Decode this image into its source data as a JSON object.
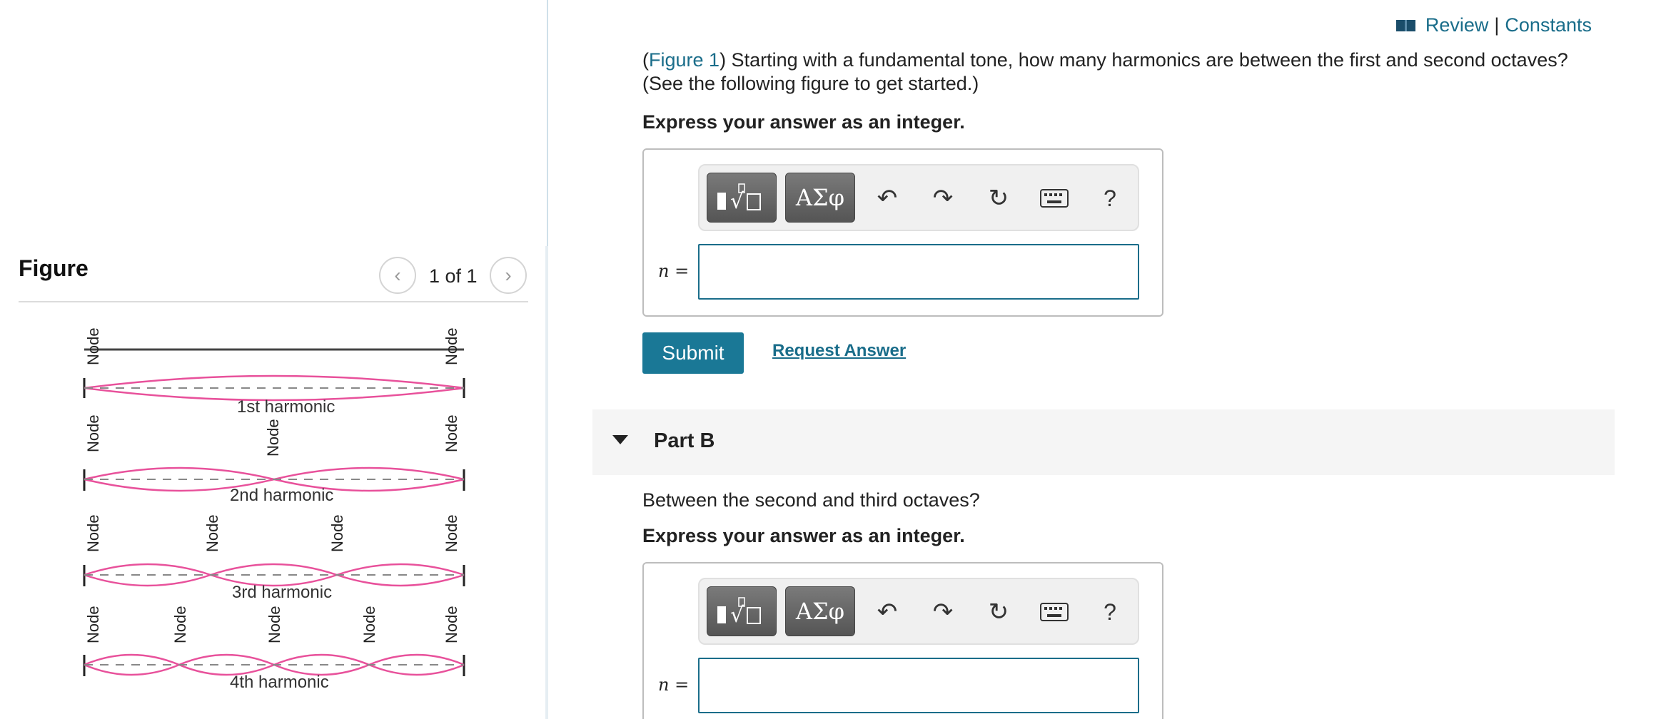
{
  "figure_panel": {
    "title": "Figure",
    "pager_text": "1 of 1",
    "prev_icon": "chevron-left-icon",
    "next_icon": "chevron-right-icon",
    "node_label": "Node",
    "harmonics": [
      {
        "label": "1st harmonic"
      },
      {
        "label": "2nd harmonic"
      },
      {
        "label": "3rd harmonic"
      },
      {
        "label": "4th harmonic"
      }
    ]
  },
  "header_links": {
    "review": "Review",
    "separator": "|",
    "constants": "Constants",
    "icon": "book-icon"
  },
  "part_a": {
    "question_prefix": "(",
    "figure_link": "Figure 1",
    "question_text": ") Starting with a fundamental tone, how many harmonics are between the first and second octaves? (See the following figure to get started.)",
    "instruction": "Express your answer as an integer.",
    "variable_label": "n =",
    "input_value": "",
    "submit_label": "Submit",
    "request_label": "Request Answer"
  },
  "toolbar": {
    "greek_label": "ΑΣφ",
    "help_label": "?",
    "icons": [
      "templates-icon",
      "greek-icon",
      "undo-icon",
      "redo-icon",
      "reset-icon",
      "keyboard-icon",
      "help-icon"
    ]
  },
  "part_b": {
    "title": "Part B",
    "question_text": "Between the second and third octaves?",
    "instruction": "Express your answer as an integer.",
    "variable_label": "n =",
    "input_value": ""
  },
  "colors": {
    "accent": "#1a7896",
    "link": "#1a6d8a",
    "wave": "#e8519b"
  }
}
